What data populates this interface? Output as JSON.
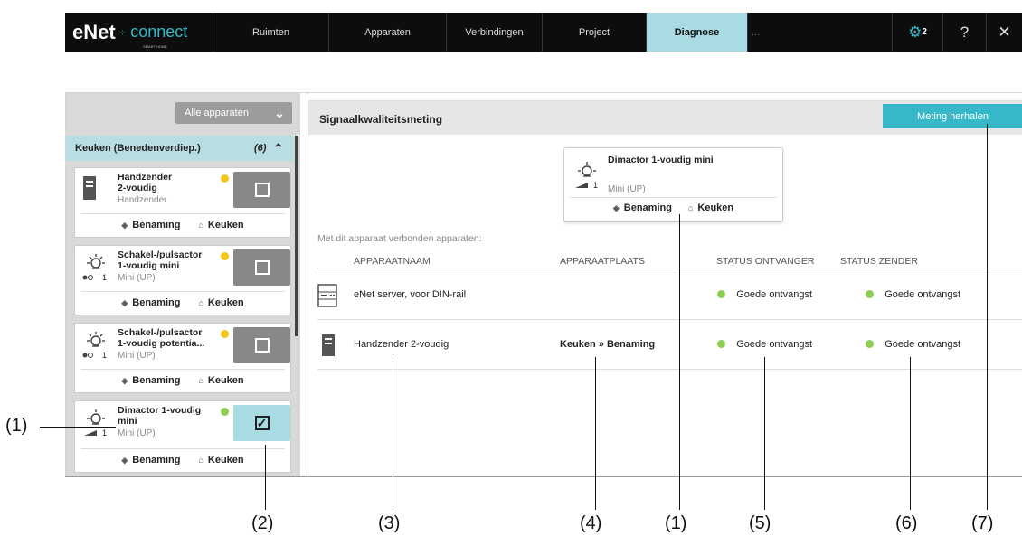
{
  "nav": {
    "logo_main": "eNet",
    "logo_sub": "SMART HOME",
    "logo_connect": "connect",
    "tabs": [
      "Ruimten",
      "Apparaten",
      "Verbindingen",
      "Project",
      "Diagnose"
    ],
    "active_tab": "Diagnose",
    "overflow": "...",
    "settings_badge": "2",
    "help": "?",
    "close": "✕"
  },
  "sidebar": {
    "filter_label": "Alle apparaten",
    "group": {
      "name": "Keuken (Benedenverdiep.)",
      "count": "(6)"
    },
    "cards": [
      {
        "name": "Handzender 2-voudig",
        "name_l1": "Handzender",
        "name_l2": "2-voudig",
        "sub": "Handzender",
        "status": "#f5c518",
        "selected": false,
        "label": "Benaming",
        "room": "Keuken"
      },
      {
        "name": "Schakel-/pulsactor 1-voudig mini",
        "name_l1": "Schakel-/pulsactor",
        "name_l2": "1-voudig mini",
        "sub": "Mini (UP)",
        "status": "#f5c518",
        "selected": false,
        "label": "Benaming",
        "room": "Keuken"
      },
      {
        "name": "Schakel-/pulsactor 1-voudig potentia...",
        "name_l1": "Schakel-/pulsactor",
        "name_l2": "1-voudig potentia...",
        "sub": "Mini (UP)",
        "status": "#f5c518",
        "selected": false,
        "label": "Benaming",
        "room": "Keuken"
      },
      {
        "name": "Dimactor 1-voudig mini",
        "name_l1": "Dimactor 1-voudig",
        "name_l2": "mini",
        "sub": "Mini (UP)",
        "status": "#8ccd52",
        "selected": true,
        "label": "Benaming",
        "room": "Keuken"
      }
    ]
  },
  "main": {
    "title": "Signaalkwaliteitsmeting",
    "repeat_button": "Meting herhalen",
    "device": {
      "name": "Dimactor 1-voudig mini",
      "sub": "Mini (UP)",
      "label": "Benaming",
      "room": "Keuken"
    },
    "connected_label": "Met dit apparaat verbonden apparaten:",
    "columns": [
      "APPARAATNAAM",
      "APPARAATPLAATS",
      "STATUS ONTVANGER",
      "STATUS ZENDER"
    ],
    "rows": [
      {
        "name": "eNet server, voor DIN-rail",
        "place": "",
        "receiver": "Goede ontvangst",
        "sender": "Goede ontvangst"
      },
      {
        "name": "Handzender 2-voudig",
        "place": "Keuken » Benaming",
        "receiver": "Goede ontvangst",
        "sender": "Goede ontvangst"
      }
    ]
  },
  "callouts": [
    "(1)",
    "(2)",
    "(3)",
    "(4)",
    "(1)",
    "(5)",
    "(6)",
    "(7)"
  ],
  "colors": {
    "accent": "#36b8c9",
    "active_tab": "#a8dbe2",
    "status_good": "#8ccd52",
    "status_warn": "#f5c518"
  }
}
